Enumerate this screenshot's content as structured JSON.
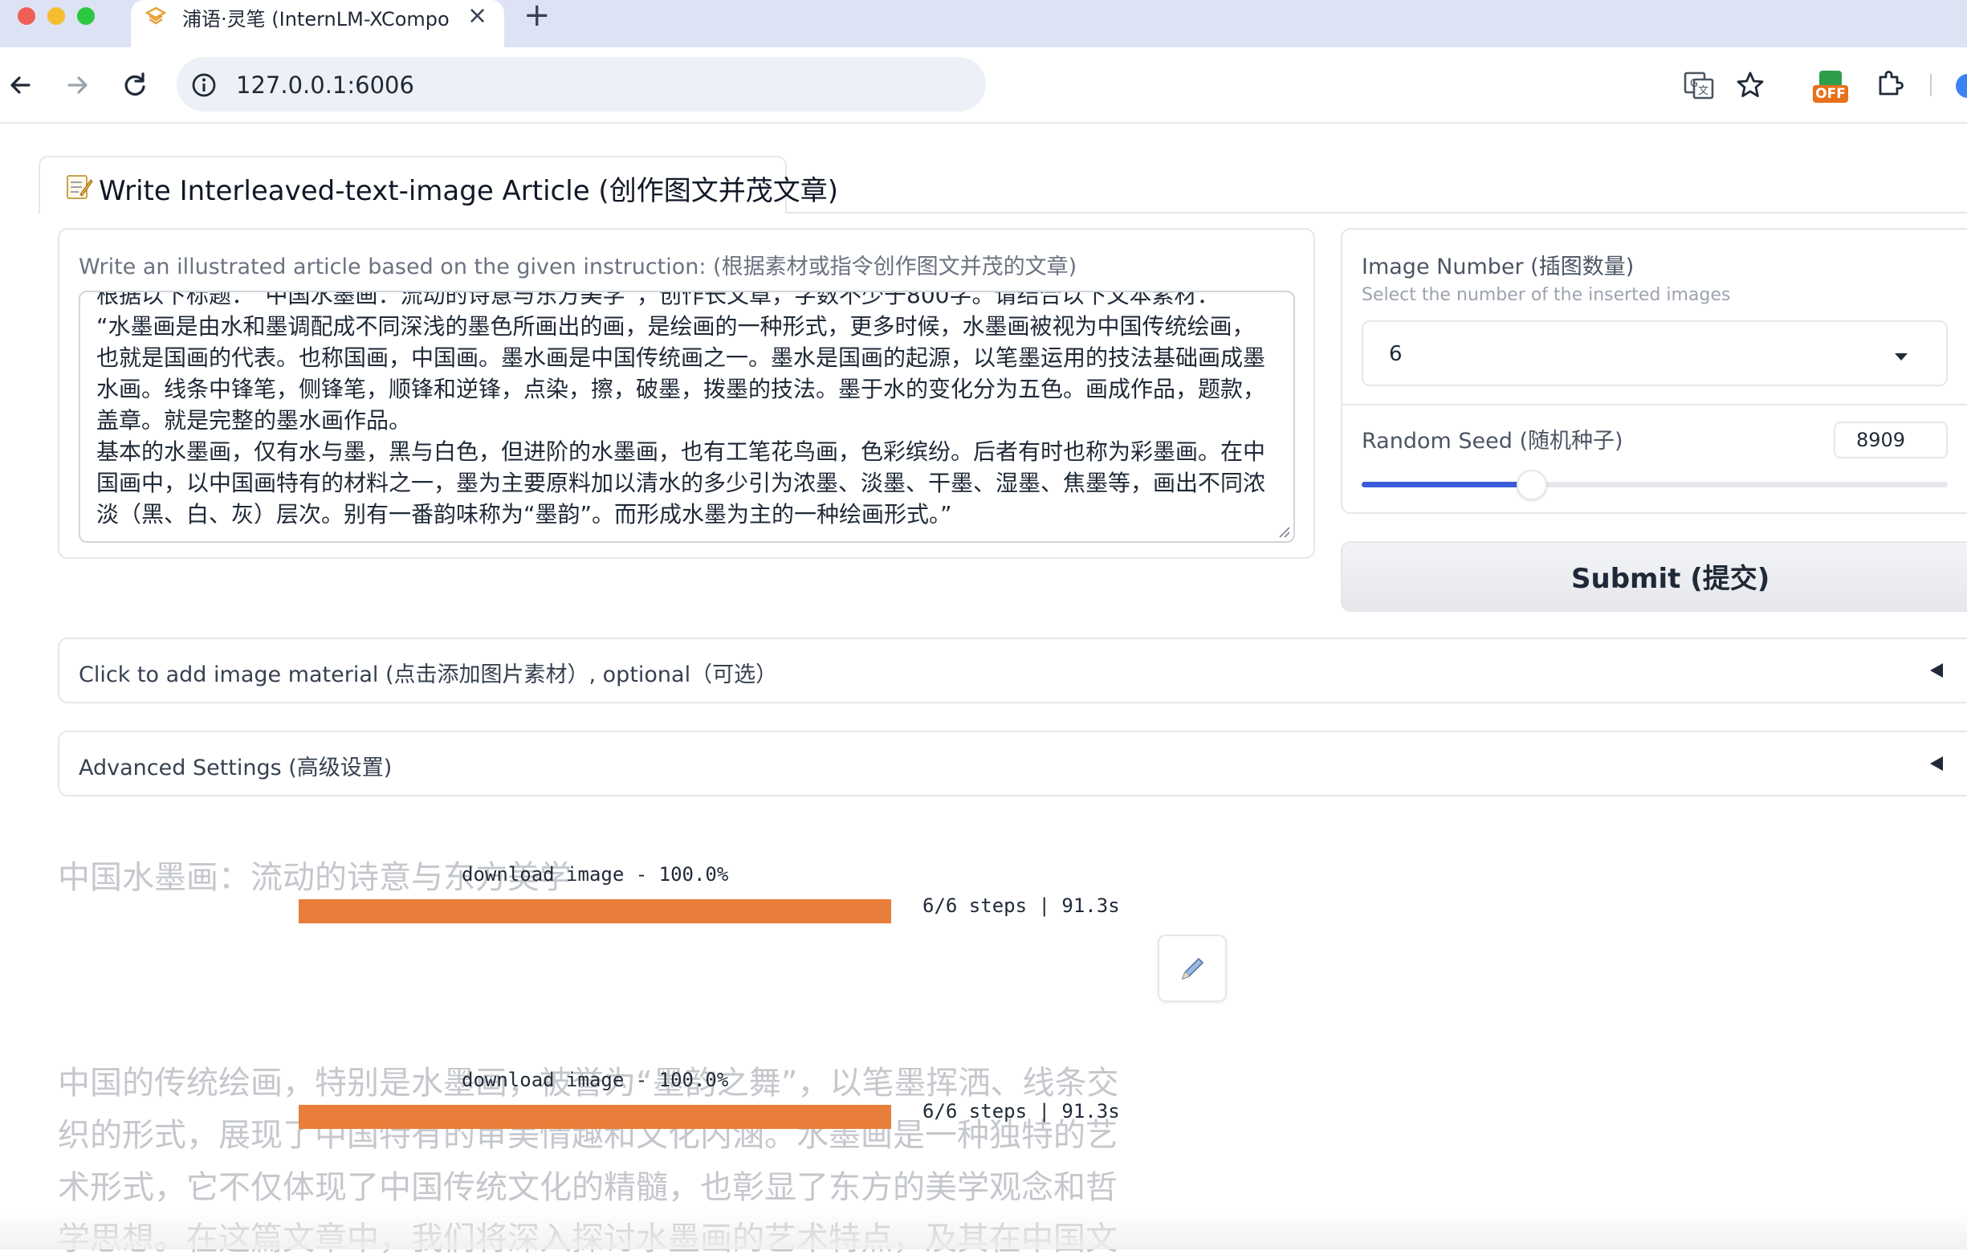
{
  "browser": {
    "tab_title": "浦语·灵笔 (InternLM-XCompo",
    "url": "127.0.0.1:6006",
    "extension_badge": "OFF"
  },
  "app": {
    "tab_label": "Write Interleaved-text-image Article (创作图文并茂文章)",
    "prompt": {
      "label": "Write an illustrated article based on the given instruction: (根据素材或指令创作图文并茂的文章)",
      "value": "根据以下标题：“中国水墨画：流动的诗意与东方美学”，创作长文章，字数不少于800字。请结合以下文本素材：\n“水墨画是由水和墨调配成不同深浅的墨色所画出的画，是绘画的一种形式，更多时候，水墨画被视为中国传统绘画，也就是国画的代表。也称国画，中国画。墨水画是中国传统画之一。墨水是国画的起源，以笔墨运用的技法基础画成墨水画。线条中锋笔，侧锋笔，顺锋和逆锋，点染，擦，破墨，拨墨的技法。墨于水的变化分为五色。画成作品，题款，盖章。就是完整的墨水画作品。\n基本的水墨画，仅有水与墨，黑与白色，但进阶的水墨画，也有工笔花鸟画，色彩缤纷。后者有时也称为彩墨画。在中国画中，以中国画特有的材料之一，墨为主要原料加以清水的多少引为浓墨、淡墨、干墨、湿墨、焦墨等，画出不同浓淡（黑、白、灰）层次。别有一番韵味称为“墨韵”。而形成水墨为主的一种绘画形式。”"
    },
    "image_number": {
      "label": "Image Number (插图数量)",
      "info": "Select the number of the inserted images",
      "value": "6"
    },
    "random_seed": {
      "label": "Random Seed (随机种子)",
      "value": "8909",
      "slider_fraction": 0.29
    },
    "submit_label": "Submit (提交)",
    "accordion_image_material": "Click to add image material (点击添加图片素材）, optional（可选）",
    "accordion_advanced": "Advanced Settings (高级设置)"
  },
  "output": {
    "title_text": "中国水墨画：流动的诗意与东方美学",
    "progress": [
      {
        "label": "download image - 100.0%",
        "steps": "6/6 steps | 91.3s",
        "fraction": 1.0
      },
      {
        "label": "download image - 100.0%",
        "steps": "6/6 steps | 91.3s",
        "fraction": 1.0
      }
    ],
    "paragraph_lines": [
      "中国的传统绘画，特别是水墨画，被誉为“墨韵之舞”，以笔墨挥洒、线条交",
      "织的形式，展现了中国特有的审美情趣和文化内涵。水墨画是一种独特的艺",
      "术形式，它不仅体现了中国传统文化的精髓，也彰显了东方的美学观念和哲",
      "学思想。在这篇文章中，我们将深入探讨水墨画的艺术特点，及其在中国文"
    ]
  }
}
